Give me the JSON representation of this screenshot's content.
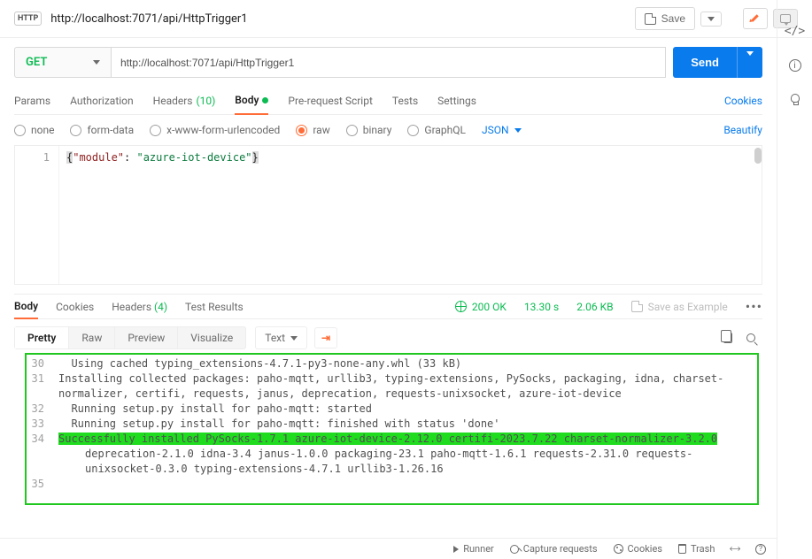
{
  "header": {
    "badge": "HTTP",
    "title": "http://localhost:7071/api/HttpTrigger1",
    "save_label": "Save"
  },
  "request": {
    "method": "GET",
    "url": "http://localhost:7071/api/HttpTrigger1",
    "send_label": "Send"
  },
  "tabs": {
    "params": "Params",
    "auth": "Authorization",
    "headers": "Headers",
    "headers_count": "(10)",
    "body": "Body",
    "prerequest": "Pre-request Script",
    "tests": "Tests",
    "settings": "Settings",
    "cookies": "Cookies"
  },
  "body_types": {
    "none": "none",
    "formdata": "form-data",
    "xwww": "x-www-form-urlencoded",
    "raw": "raw",
    "binary": "binary",
    "graphql": "GraphQL",
    "format": "JSON",
    "beautify": "Beautify"
  },
  "editor": {
    "line_no": "1",
    "open_brace": "{",
    "key": "\"module\"",
    "colon": ": ",
    "value": "\"azure-iot-device\"",
    "close_brace": "}"
  },
  "response": {
    "tabs": {
      "body": "Body",
      "cookies": "Cookies",
      "headers": "Headers",
      "headers_count": "(4)",
      "tests": "Test Results"
    },
    "status_code": "200 OK",
    "time": "13.30 s",
    "size": "2.06 KB",
    "save_example": "Save as Example",
    "views": {
      "pretty": "Pretty",
      "raw": "Raw",
      "preview": "Preview",
      "visualize": "Visualize",
      "text": "Text"
    },
    "lines": [
      {
        "no": "30",
        "text": "  Using cached typing_extensions-4.7.1-py3-none-any.whl (33 kB)",
        "indent": false
      },
      {
        "no": "31",
        "text": "Installing collected packages: paho-mqtt, urllib3, typing-extensions, PySocks, packaging, idna, charset-normalizer, certifi, requests, janus, deprecation, requests-unixsocket, azure-iot-device",
        "indent": false
      },
      {
        "no": "32",
        "text": "  Running setup.py install for paho-mqtt: started",
        "indent": false
      },
      {
        "no": "33",
        "text": "  Running setup.py install for paho-mqtt: finished with status 'done'",
        "indent": false
      },
      {
        "no": "34",
        "text": "Successfully installed PySocks-1.7.1 azure-iot-device-2.12.0 certifi-2023.7.22 charset-normalizer-3.2.0",
        "indent": false,
        "hl": true
      },
      {
        "no": "",
        "text": "deprecation-2.1.0 idna-3.4 janus-1.0.0 packaging-23.1 paho-mqtt-1.6.1 requests-2.31.0 requests-unixsocket-0.3.0 typing-extensions-4.7.1 urllib3-1.26.16",
        "indent": true
      },
      {
        "no": "35",
        "text": "",
        "indent": false
      }
    ]
  },
  "bottom": {
    "runner": "Runner",
    "capture": "Capture requests",
    "cookies": "Cookies",
    "trash": "Trash"
  }
}
